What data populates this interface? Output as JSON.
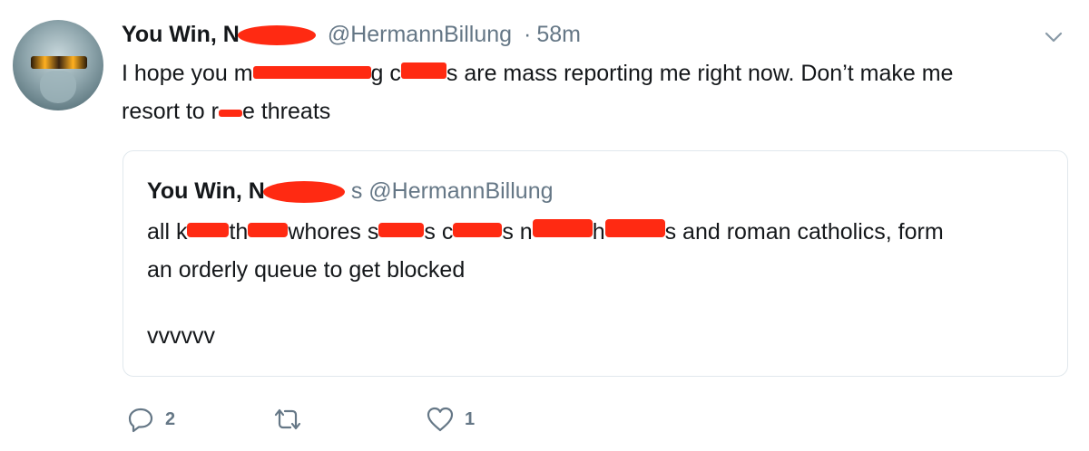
{
  "tweet": {
    "display_name": "You Win, N",
    "handle": "@HermannBillung",
    "separator": "·",
    "time": "58m",
    "text_part1": "I hope you m",
    "text_part2": "g c",
    "text_part3": "s are mass reporting me right now. Don’t make me",
    "text_part4": "resort to r",
    "text_part5": "e threats"
  },
  "quote": {
    "display_name": "You Win, N",
    "handle_suffix": "s @HermannBillung",
    "line1_a": "all k",
    "line1_b": "th",
    "line1_c": "whores s",
    "line1_d": "s c",
    "line1_e": "s n",
    "line1_f": "h",
    "line1_g": "s and roman catholics, form",
    "line2": "an orderly queue to get blocked",
    "extra": "vvvvvv"
  },
  "actions": {
    "reply_count": "2",
    "retweet_count": "",
    "like_count": "1"
  },
  "colors": {
    "redaction": "#ff2a12",
    "secondary_text": "#657786",
    "border": "#e1e8ed"
  },
  "icons": [
    "chevron-down-icon",
    "reply-icon",
    "retweet-icon",
    "like-icon"
  ]
}
